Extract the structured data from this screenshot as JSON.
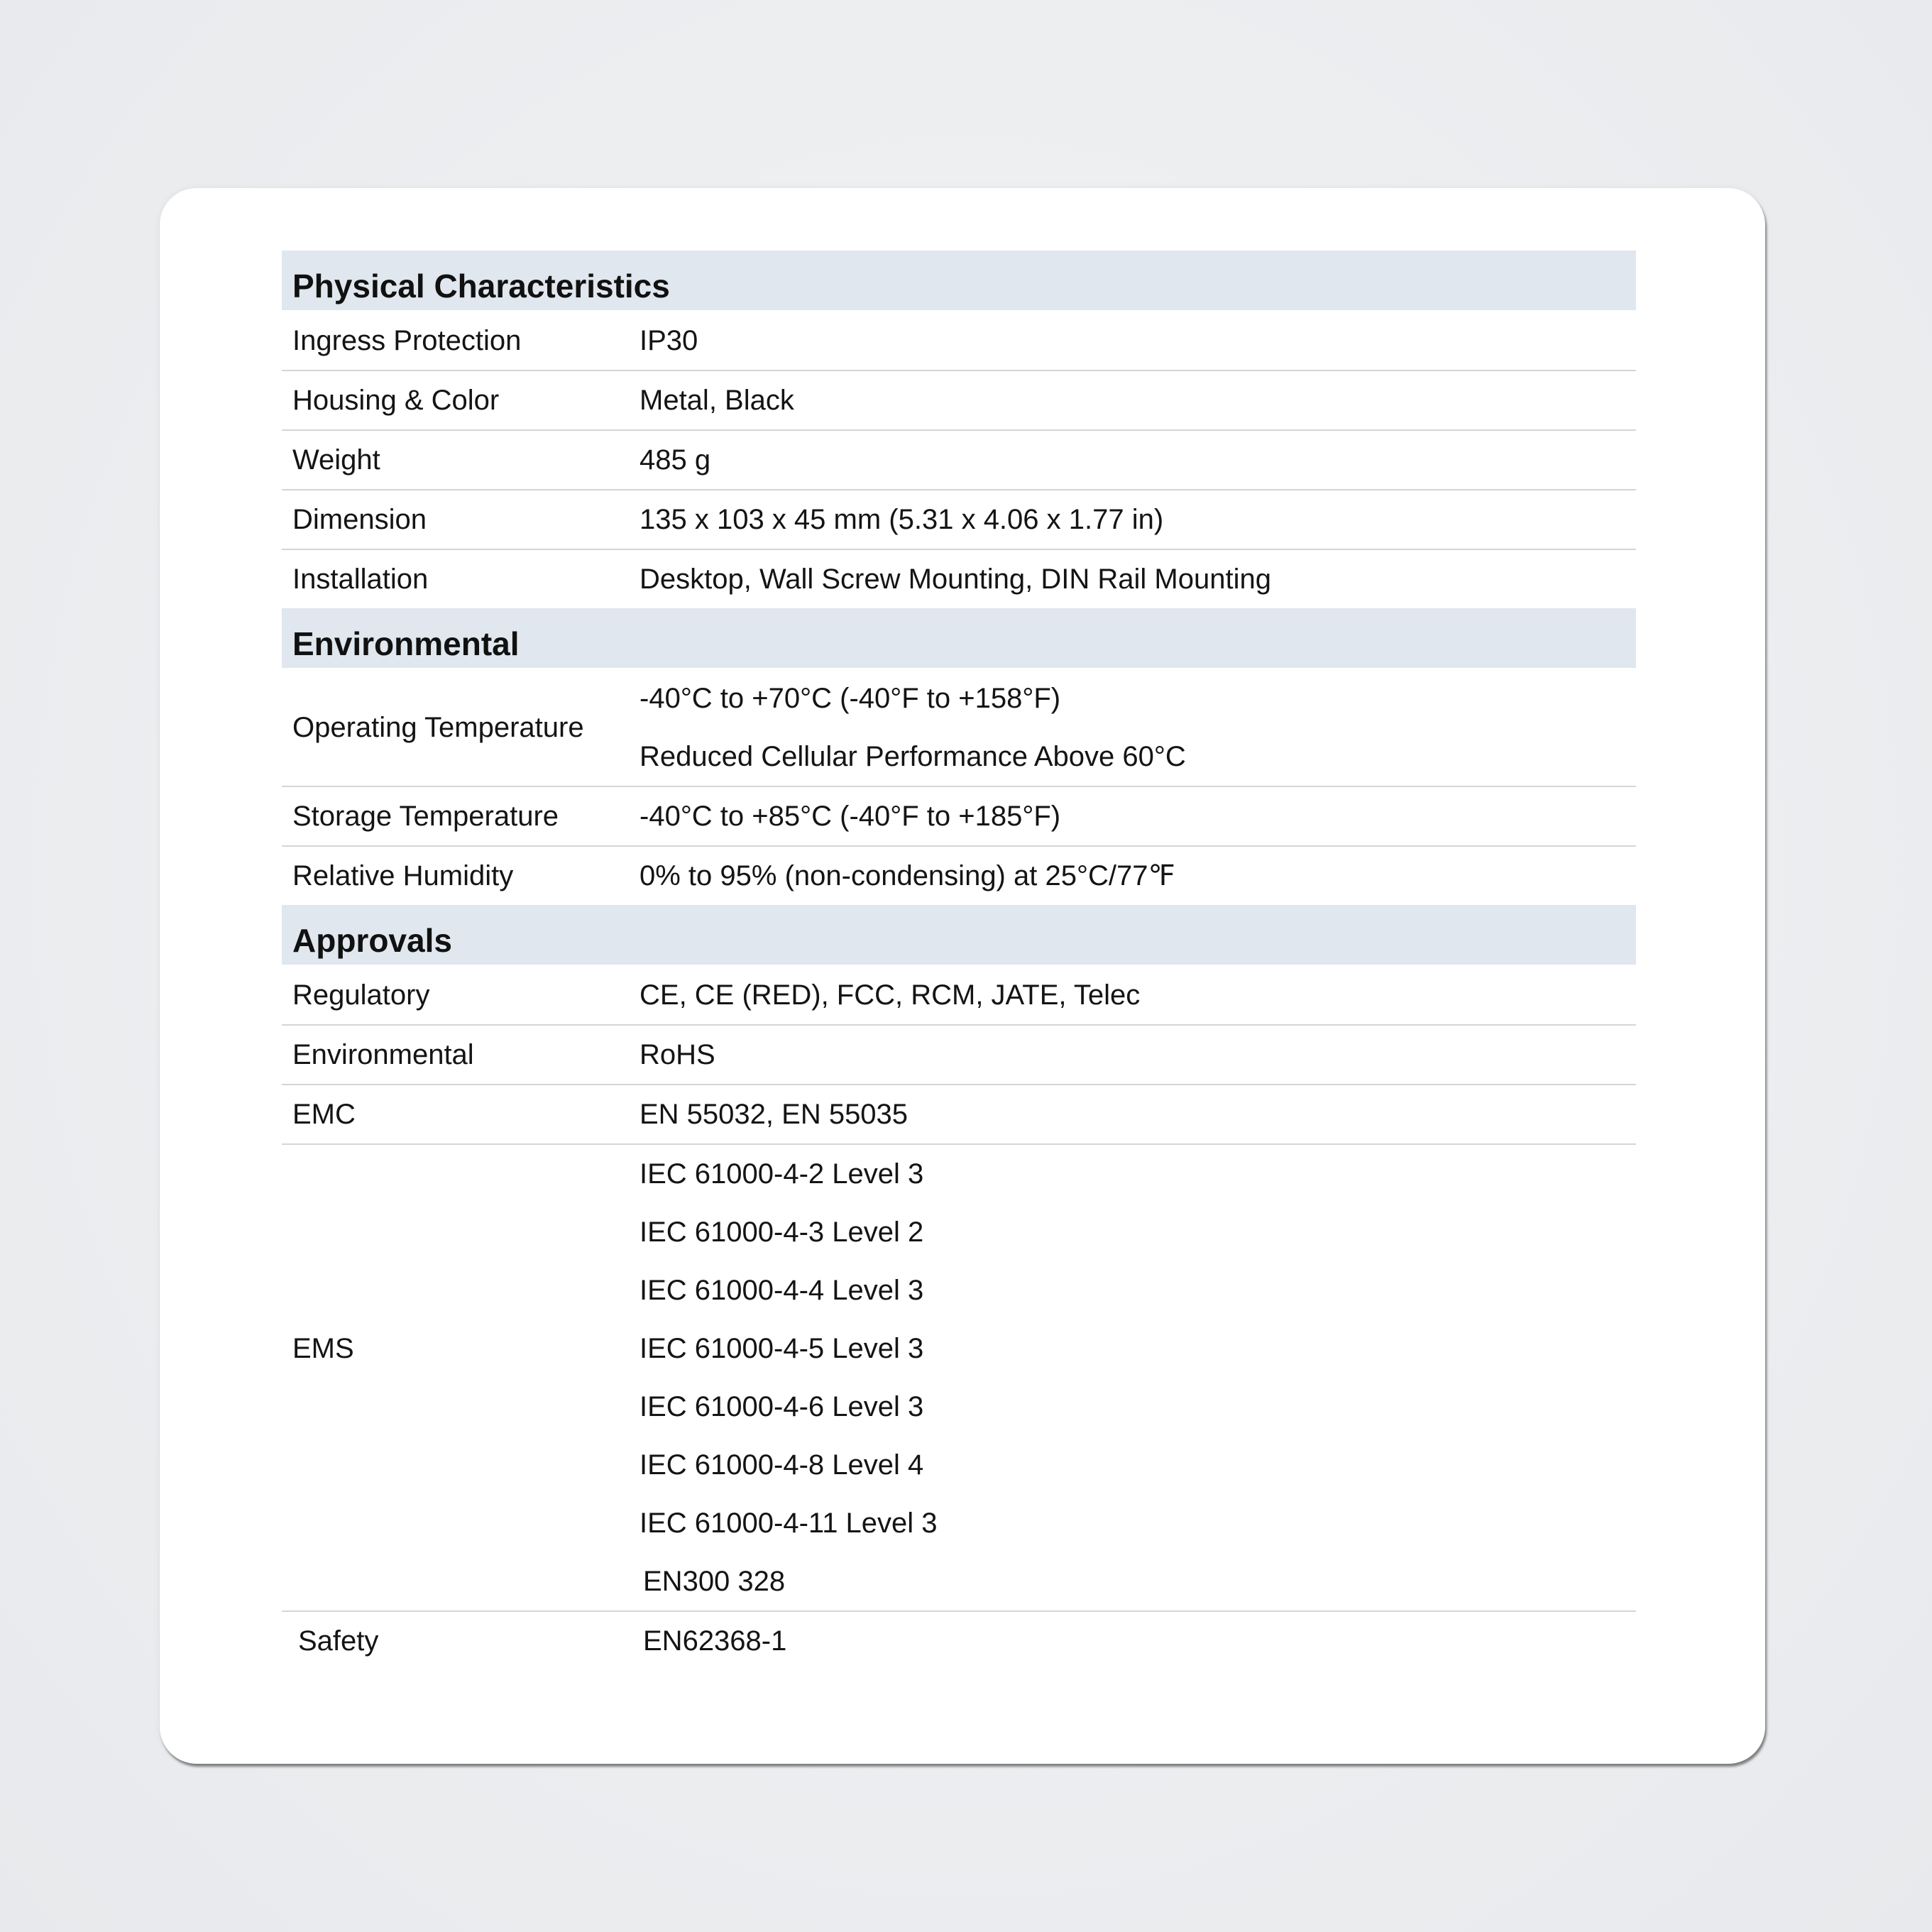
{
  "sections": [
    {
      "title": "Physical Characteristics",
      "rows": [
        {
          "label": "Ingress Protection",
          "values": [
            "IP30"
          ]
        },
        {
          "label": "Housing & Color",
          "values": [
            "Metal, Black"
          ]
        },
        {
          "label": "Weight",
          "values": [
            "485 g"
          ]
        },
        {
          "label": "Dimension",
          "values": [
            "135 x 103 x 45 mm (5.31 x 4.06 x 1.77 in)"
          ]
        },
        {
          "label": "Installation",
          "values": [
            "Desktop, Wall Screw Mounting, DIN Rail Mounting"
          ]
        }
      ]
    },
    {
      "title": "Environmental",
      "rows": [
        {
          "label": "Operating Temperature",
          "values": [
            "-40°C to +70°C (-40°F to +158°F)",
            "Reduced Cellular Performance Above 60°C"
          ]
        },
        {
          "label": "Storage Temperature",
          "values": [
            "-40°C to +85°C (-40°F to +185°F)"
          ]
        },
        {
          "label": "Relative Humidity",
          "values": [
            "0% to 95% (non-condensing) at 25°C/77℉"
          ]
        }
      ]
    },
    {
      "title": "Approvals",
      "rows": [
        {
          "label": "Regulatory",
          "values": [
            "CE, CE (RED), FCC, RCM, JATE, Telec"
          ]
        },
        {
          "label": "Environmental",
          "values": [
            "RoHS"
          ]
        },
        {
          "label": "EMC",
          "values": [
            "EN 55032, EN 55035"
          ]
        },
        {
          "label": "EMS",
          "values": [
            "IEC 61000-4-2 Level 3",
            "IEC 61000-4-3 Level 2",
            "IEC 61000-4-4 Level 3",
            "IEC 61000-4-5 Level 3",
            "IEC 61000-4-6 Level 3",
            "IEC 61000-4-8 Level 4",
            "IEC 61000-4-11 Level 3"
          ]
        },
        {
          "label": "",
          "values": [
            "EN300 328"
          ]
        },
        {
          "label": "Safety",
          "values": [
            "EN62368-1"
          ]
        }
      ]
    }
  ]
}
